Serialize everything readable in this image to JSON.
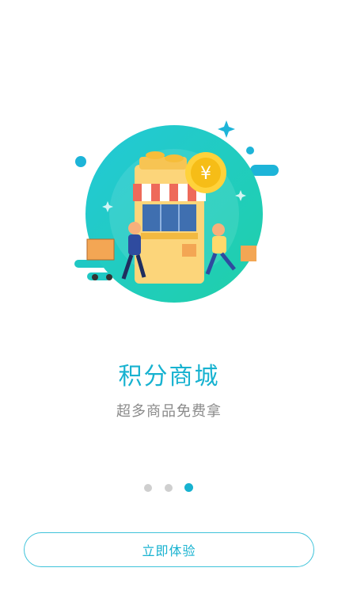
{
  "onboarding": {
    "title": "积分商城",
    "subtitle": "超多商品免费拿",
    "page_indicator": {
      "total": 3,
      "active": 3
    },
    "cta_label": "立即体验"
  },
  "colors": {
    "accent": "#17b2d0",
    "subtitle": "#8a8a8a",
    "dot_inactive": "#cfcfcf",
    "illustration_teal": "#1fc8c4"
  },
  "icons": [
    "shop-illustration-icon",
    "yuan-coin-icon"
  ]
}
